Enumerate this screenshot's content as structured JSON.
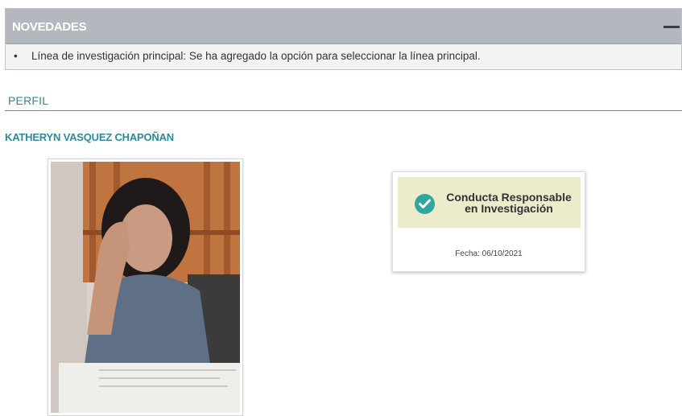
{
  "news": {
    "title": "NOVEDADES",
    "items": [
      "Línea de investigación principal: Se ha agregado la opción para seleccionar la línea principal."
    ],
    "bullet": "•"
  },
  "profile": {
    "section_title": "PERFIL",
    "name": "KATHERYN VASQUEZ CHAPOÑAN",
    "photo_icon": "profile-photo"
  },
  "certificate": {
    "line1": "Conducta Responsable",
    "line2": "en Investigación",
    "date": "Fecha: 06/10/2021",
    "icon": "check-circle-icon"
  },
  "colors": {
    "accent": "#2a8c9a",
    "news_header": "#b4b8be",
    "cert_banner": "#ecebcb",
    "check": "#2fa79c"
  }
}
